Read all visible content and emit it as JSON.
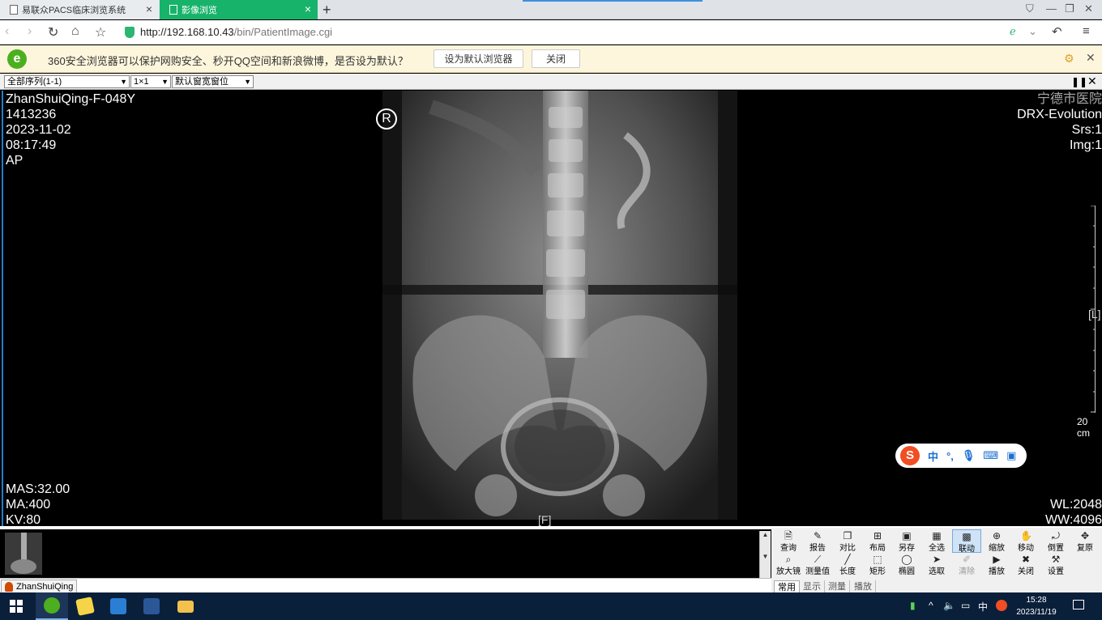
{
  "browser": {
    "tabs": [
      {
        "label": "易联众PACS临床浏览系统"
      },
      {
        "label": "影像浏览"
      }
    ],
    "url_host": "http://192.168.10.43",
    "url_path": "/bin/PatientImage.cgi"
  },
  "notification": {
    "message": "360安全浏览器可以保护网购安全、秒开QQ空间和新浪微博，是否设为默认？",
    "set_default_label": "设为默认浏览器",
    "close_label": "关闭"
  },
  "pacs_toolbar": {
    "series_select": "全部序列(1-1)",
    "layout_select": "1×1",
    "window_select": "默认窗宽窗位"
  },
  "overlay": {
    "top_left": [
      "ZhanShuiQing-F-048Y",
      "1413236",
      "2023-11-02",
      "08:17:49",
      "AP"
    ],
    "top_right": [
      "宁德市医院",
      "DRX-Evolution",
      "Srs:1",
      "Img:1"
    ],
    "bottom_left": [
      "MAS:32.00",
      "MA:400",
      "KV:80"
    ],
    "bottom_right": [
      "WL:2048",
      "WW:4096"
    ],
    "orientation_right": "[L]",
    "orientation_bottom": "[F]",
    "ruler_label": "20 cm"
  },
  "ime": {
    "items": [
      "中",
      "°,",
      "🎤",
      "⌨",
      "🔒"
    ]
  },
  "thumbnail": {
    "patient_tab": "ZhanShuiQing"
  },
  "tools": {
    "row1": [
      "查询",
      "报告",
      "对比",
      "布局",
      "另存",
      "全选",
      "联动",
      "缩放",
      "移动",
      "倒置",
      "复原"
    ],
    "row2": [
      "放大镜",
      "测量值",
      "长度",
      "矩形",
      "椭圆",
      "选取",
      "清除",
      "播放",
      "关闭",
      "设置"
    ],
    "tabs": [
      "常用",
      "显示",
      "测量",
      "播放"
    ]
  },
  "taskbar": {
    "tray_lang": "中",
    "time": "15:28",
    "date": "2023/11/19"
  },
  "colors": {
    "active_tab": "#18b36b",
    "taskbar": "#0a1f3a",
    "notification_bg": "#fdf6dc"
  }
}
